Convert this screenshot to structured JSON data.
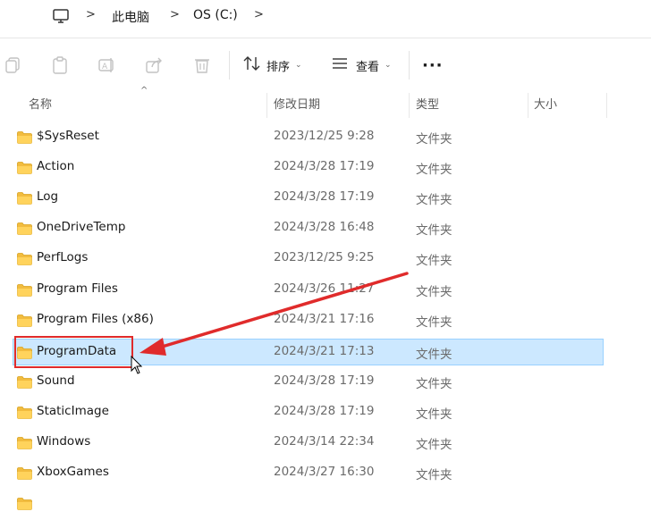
{
  "address_bar": {
    "crumbs": [
      "此电脑",
      "OS (C:)"
    ],
    "separator": ">"
  },
  "toolbar": {
    "sort_label": "排序",
    "view_label": "查看",
    "more_label": "···"
  },
  "columns": {
    "name": "名称",
    "date": "修改日期",
    "type": "类型",
    "size": "大小"
  },
  "files": [
    {
      "name": "$SysReset",
      "date": "2023/12/25 9:28",
      "type": "文件夹"
    },
    {
      "name": "Action",
      "date": "2024/3/28 17:19",
      "type": "文件夹"
    },
    {
      "name": "Log",
      "date": "2024/3/28 17:19",
      "type": "文件夹"
    },
    {
      "name": "OneDriveTemp",
      "date": "2024/3/28 16:48",
      "type": "文件夹"
    },
    {
      "name": "PerfLogs",
      "date": "2023/12/25 9:25",
      "type": "文件夹"
    },
    {
      "name": "Program Files",
      "date": "2024/3/26 11:27",
      "type": "文件夹"
    },
    {
      "name": "Program Files (x86)",
      "date": "2024/3/21 17:16",
      "type": "文件夹"
    },
    {
      "name": "ProgramData",
      "date": "2024/3/21 17:13",
      "type": "文件夹",
      "selected": true
    },
    {
      "name": "Sound",
      "date": "2024/3/28 17:19",
      "type": "文件夹"
    },
    {
      "name": "StaticImage",
      "date": "2024/3/28 17:19",
      "type": "文件夹"
    },
    {
      "name": "Windows",
      "date": "2024/3/14 22:34",
      "type": "文件夹"
    },
    {
      "name": "XboxGames",
      "date": "2024/3/27 16:30",
      "type": "文件夹"
    }
  ],
  "colors": {
    "selection_fill": "#cce8ff",
    "selection_border": "#99d1ff",
    "annotation_red": "#e02b2b",
    "folder_yellow": "#f5c542"
  }
}
